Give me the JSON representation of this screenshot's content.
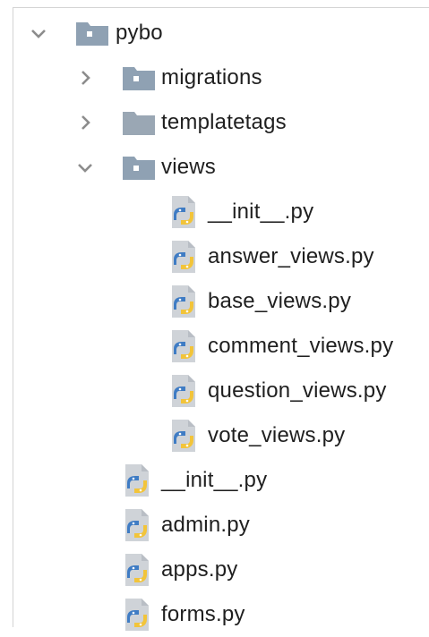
{
  "tree": {
    "root": {
      "name": "pybo",
      "expanded": true,
      "icon": "folder-icon",
      "children": [
        {
          "name": "migrations",
          "expanded": false,
          "icon": "folder-icon"
        },
        {
          "name": "templatetags",
          "expanded": false,
          "icon": "folder-icon"
        },
        {
          "name": "views",
          "expanded": true,
          "icon": "folder-icon",
          "files": [
            "__init__.py",
            "answer_views.py",
            "base_views.py",
            "comment_views.py",
            "question_views.py",
            "vote_views.py"
          ]
        }
      ],
      "files": [
        "__init__.py",
        "admin.py",
        "apps.py",
        "forms.py"
      ]
    }
  },
  "colors": {
    "folder": "#8fa1b3",
    "folder_plain": "#9aa7b4",
    "arrow": "#8c8c8c",
    "python_blue": "#3f7cc4",
    "python_yellow": "#f2c43a",
    "page": "#cfd3d8"
  }
}
